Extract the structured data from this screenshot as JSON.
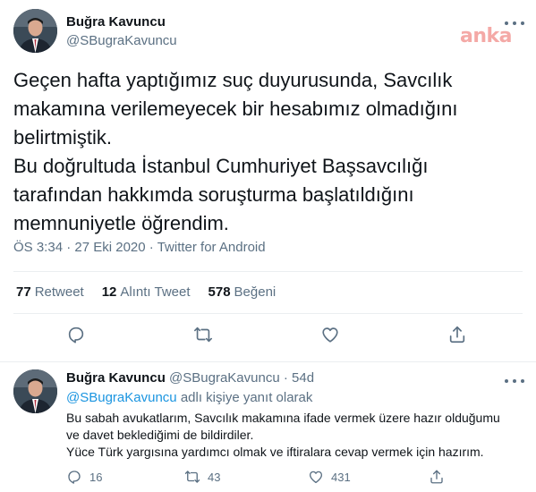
{
  "main_tweet": {
    "author_name": "Buğra Kavuncu",
    "handle": "@SBugraKavuncu",
    "watermark": "anka",
    "text_lines": [
      "Geçen hafta yaptığımız suç duyurusunda, Savcılık",
      "makamına verilemeyecek bir hesabımız olmadığını",
      "belirtmiştik.",
      "Bu doğrultuda İstanbul Cumhuriyet Başsavcılığı",
      "tarafından hakkımda soruşturma başlatıldığını",
      "memnuniyetle öğrendim."
    ],
    "time": "ÖS 3:34",
    "date": "27 Eki 2020",
    "separator": "·",
    "source": "Twitter for Android",
    "stats": {
      "retweets_count": "77",
      "retweets_label": "Retweet",
      "quotes_count": "12",
      "quotes_label": "Alıntı Tweet",
      "likes_count": "578",
      "likes_label": "Beğeni"
    },
    "icons": [
      "reply-icon",
      "retweet-icon",
      "like-icon",
      "share-icon",
      "more-icon"
    ]
  },
  "reply_tweet": {
    "author_name": "Buğra Kavuncu",
    "handle": "@SBugraKavuncu",
    "separator": "·",
    "age": "54d",
    "replying_mention": "@SBugraKavuncu",
    "replying_suffix": "adlı kişiye yanıt olarak",
    "text_lines": [
      "Bu sabah avukatlarım, Savcılık makamına ifade vermek üzere hazır olduğumu",
      "ve davet beklediğimi de bildirdiler.",
      "Yüce Türk yargısına yardımcı olmak ve iftiralara cevap vermek için hazırım."
    ],
    "reply_count": "16",
    "retweet_count": "43",
    "like_count": "431"
  },
  "colors": {
    "text": "#0f1419",
    "secondary": "#5b7083",
    "link": "#1b95e0",
    "divider": "#ebeef0",
    "watermark": "#f4a9a6"
  }
}
